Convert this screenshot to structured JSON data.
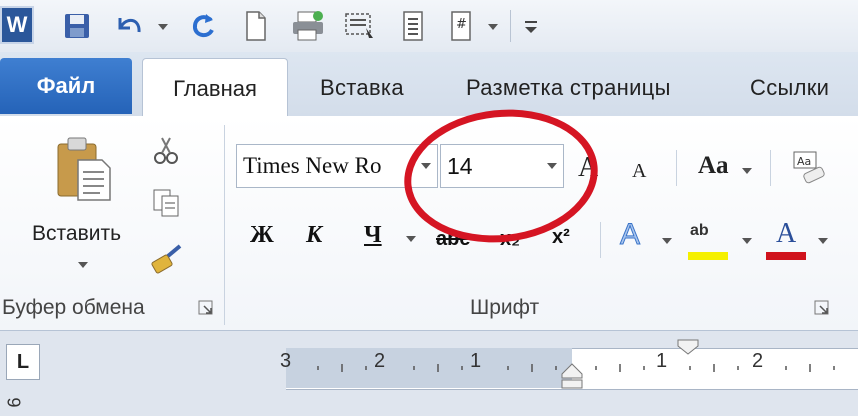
{
  "app": {
    "logo_letter": "W"
  },
  "tabs": {
    "file": "Файл",
    "home": "Главная",
    "insert": "Вставка",
    "page_layout": "Разметка страницы",
    "references": "Ссылки"
  },
  "clipboard": {
    "paste_label": "Вставить",
    "group_label": "Буфер обмена"
  },
  "font": {
    "font_name": "Times New Ro",
    "font_size": "14",
    "group_label": "Шрифт",
    "grow_glyph": "A",
    "shrink_glyph": "A",
    "change_case_glyph": "Aa",
    "bold": "Ж",
    "italic": "К",
    "underline": "Ч",
    "strikethrough": "abe",
    "subscript": "x₂",
    "superscript": "x²",
    "text_effects_glyph": "A",
    "highlight_glyph": "ab",
    "font_color_glyph": "A",
    "highlight_color": "#f5f000",
    "font_color": "#d0131d"
  },
  "ruler": {
    "corner_symbol": "L",
    "numbers": [
      "3",
      "2",
      "1",
      "1",
      "2"
    ],
    "vertical_number": "6"
  },
  "annotation_color": "#d51523"
}
